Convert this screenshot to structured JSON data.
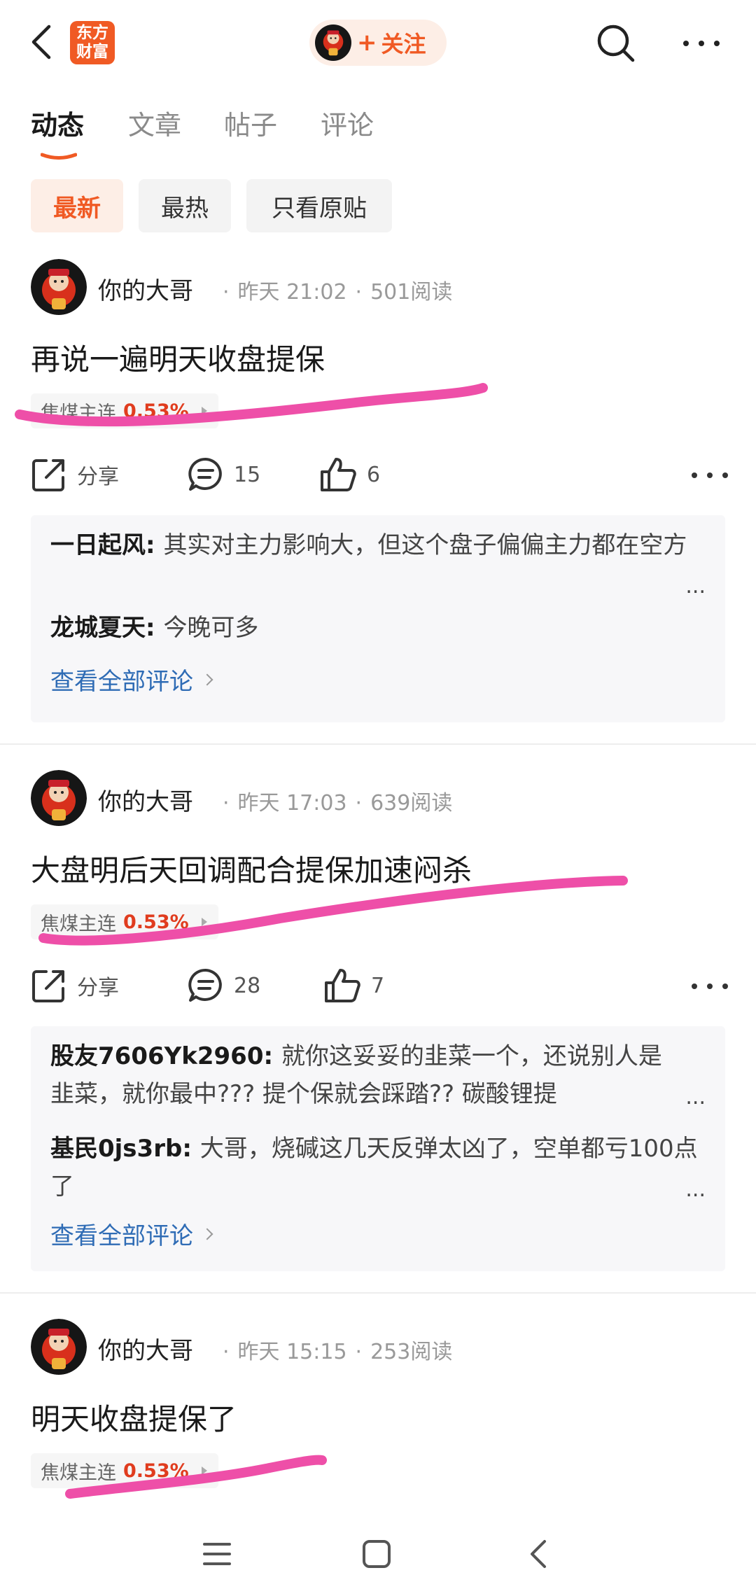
{
  "header": {
    "logo_text_line1": "东方",
    "logo_text_line2": "财富",
    "follow_label": "关注",
    "follow_plus": "+",
    "brand_color": "#f05a24"
  },
  "tabs": [
    {
      "label": "动态",
      "active": true
    },
    {
      "label": "文章",
      "active": false
    },
    {
      "label": "帖子",
      "active": false
    },
    {
      "label": "评论",
      "active": false
    }
  ],
  "filters": [
    {
      "label": "最新",
      "active": true
    },
    {
      "label": "最热",
      "active": false
    },
    {
      "label": "只看原贴",
      "active": false
    }
  ],
  "actions": {
    "share_label": "分享"
  },
  "posts": [
    {
      "author": "你的大哥",
      "time": "昨天 21:02",
      "reads": "501阅读",
      "title": "再说一遍明天收盘提保",
      "stock_name": "焦煤主连",
      "stock_change": "0.53%",
      "comment_count": "15",
      "like_count": "6",
      "comments": [
        {
          "name": "一日起风",
          "text": "其实对主力影响大，但这个盘子偏偏主力都在空方"
        },
        {
          "name": "龙城夏天",
          "text": "今晚可多"
        }
      ],
      "view_all": "查看全部评论"
    },
    {
      "author": "你的大哥",
      "time": "昨天 17:03",
      "reads": "639阅读",
      "title": "大盘明后天回调配合提保加速闷杀",
      "stock_name": "焦煤主连",
      "stock_change": "0.53%",
      "comment_count": "28",
      "like_count": "7",
      "comments": [
        {
          "name": "股友7606Yk2960",
          "text": "就你这妥妥的韭菜一个，还说别人是韭菜，就你最中??? 提个保就会踩踏?? 碳酸锂提"
        },
        {
          "name": "基民0js3rb",
          "text": "大哥，烧碱这几天反弹太凶了，空单都亏100点了"
        }
      ],
      "view_all": "查看全部评论"
    },
    {
      "author": "你的大哥",
      "time": "昨天 15:15",
      "reads": "253阅读",
      "title": "明天收盘提保了",
      "stock_name": "焦煤主连",
      "stock_change": "0.53%"
    }
  ],
  "colors": {
    "accent": "#f05a24",
    "stock_change": "#e03c1e",
    "link": "#2f6cb5",
    "scribble": "#ee4fa8"
  }
}
